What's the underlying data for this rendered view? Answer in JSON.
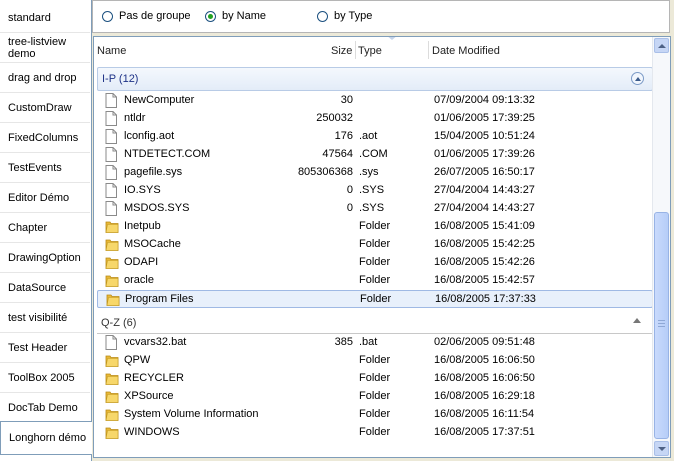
{
  "tabs": [
    {
      "label": "standard"
    },
    {
      "label": "tree-listview demo"
    },
    {
      "label": "drag and drop"
    },
    {
      "label": "CustomDraw"
    },
    {
      "label": "FixedColumns"
    },
    {
      "label": "TestEvents"
    },
    {
      "label": "Editor Démo"
    },
    {
      "label": "Chapter"
    },
    {
      "label": "DrawingOption"
    },
    {
      "label": "DataSource"
    },
    {
      "label": "test visibilité"
    },
    {
      "label": "Test Header"
    },
    {
      "label": "ToolBox 2005"
    },
    {
      "label": "DocTab Demo"
    },
    {
      "label": "Longhorn démo"
    }
  ],
  "active_tab": "Longhorn démo",
  "grouping": {
    "options": [
      {
        "label": "Pas de groupe",
        "selected": false
      },
      {
        "label": "by Name",
        "selected": true
      },
      {
        "label": "by Type",
        "selected": false
      }
    ]
  },
  "columns": {
    "name": "Name",
    "size": "Size",
    "type": "Type",
    "date": "Date Modified"
  },
  "groups": [
    {
      "title": "I-P (12)",
      "rows": [
        {
          "name": "NewComputer",
          "size": "30",
          "type": "",
          "date": "07/09/2004 09:13:32",
          "kind": "file"
        },
        {
          "name": "ntldr",
          "size": "250032",
          "type": "",
          "date": "01/06/2005 17:39:25",
          "kind": "file"
        },
        {
          "name": "lconfig.aot",
          "size": "176",
          "type": ".aot",
          "date": "15/04/2005 10:51:24",
          "kind": "file"
        },
        {
          "name": "NTDETECT.COM",
          "size": "47564",
          "type": ".COM",
          "date": "01/06/2005 17:39:26",
          "kind": "file"
        },
        {
          "name": "pagefile.sys",
          "size": "805306368",
          "type": ".sys",
          "date": "26/07/2005 16:50:17",
          "kind": "file"
        },
        {
          "name": "IO.SYS",
          "size": "0",
          "type": ".SYS",
          "date": "27/04/2004 14:43:27",
          "kind": "file"
        },
        {
          "name": "MSDOS.SYS",
          "size": "0",
          "type": ".SYS",
          "date": "27/04/2004 14:43:27",
          "kind": "file"
        },
        {
          "name": "Inetpub",
          "size": "",
          "type": "Folder",
          "date": "16/08/2005 15:41:09",
          "kind": "folder"
        },
        {
          "name": "MSOCache",
          "size": "",
          "type": "Folder",
          "date": "16/08/2005 15:42:25",
          "kind": "folder"
        },
        {
          "name": "ODAPI",
          "size": "",
          "type": "Folder",
          "date": "16/08/2005 15:42:26",
          "kind": "folder"
        },
        {
          "name": "oracle",
          "size": "",
          "type": "Folder",
          "date": "16/08/2005 15:42:57",
          "kind": "folder"
        },
        {
          "name": "Program Files",
          "size": "",
          "type": "Folder",
          "date": "16/08/2005 17:37:33",
          "kind": "folder",
          "selected": true
        }
      ]
    },
    {
      "title": "Q-Z (6)",
      "rows": [
        {
          "name": "vcvars32.bat",
          "size": "385",
          "type": ".bat",
          "date": "02/06/2005 09:51:48",
          "kind": "file"
        },
        {
          "name": "QPW",
          "size": "",
          "type": "Folder",
          "date": "16/08/2005 16:06:50",
          "kind": "folder"
        },
        {
          "name": "RECYCLER",
          "size": "",
          "type": "Folder",
          "date": "16/08/2005 16:06:50",
          "kind": "folder"
        },
        {
          "name": "XPSource",
          "size": "",
          "type": "Folder",
          "date": "16/08/2005 16:29:18",
          "kind": "folder"
        },
        {
          "name": "System Volume Information",
          "size": "",
          "type": "Folder",
          "date": "16/08/2005 16:11:54",
          "kind": "folder"
        },
        {
          "name": "WINDOWS",
          "size": "",
          "type": "Folder",
          "date": "16/08/2005 17:37:51",
          "kind": "folder"
        }
      ]
    }
  ],
  "icons": {
    "file": "document-icon",
    "folder": "folder-icon",
    "collapse": "chevron-up-icon"
  }
}
